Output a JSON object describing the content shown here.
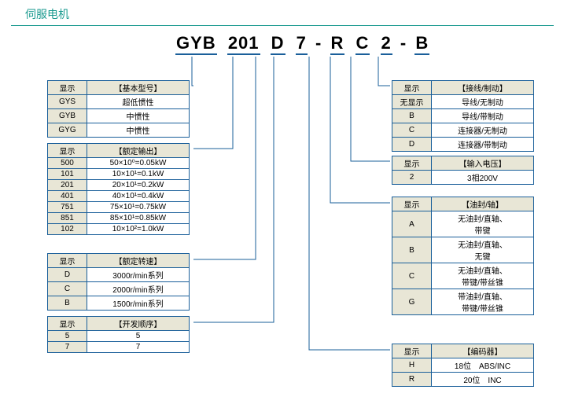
{
  "title": "伺服电机",
  "model": {
    "p1": "GYB",
    "p2": "201",
    "p3": "D",
    "p4": "7",
    "dash1": "-",
    "p5": "R",
    "p6": "C",
    "p7": "2",
    "dash2": "-",
    "p8": "B"
  },
  "t1": {
    "h1": "显示",
    "h2": "【基本型号】",
    "r": [
      [
        "GYS",
        "超低惯性"
      ],
      [
        "GYB",
        "中惯性"
      ],
      [
        "GYG",
        "中惯性"
      ]
    ]
  },
  "t2": {
    "h1": "显示",
    "h2": "【额定输出】",
    "r": [
      [
        "500",
        "50×10⁰=0.05kW"
      ],
      [
        "101",
        "10×10¹=0.1kW"
      ],
      [
        "201",
        "20×10¹=0.2kW"
      ],
      [
        "401",
        "40×10¹=0.4kW"
      ],
      [
        "751",
        "75×10¹=0.75kW"
      ],
      [
        "851",
        "85×10¹=0.85kW"
      ],
      [
        "102",
        "10×10²=1.0kW"
      ]
    ]
  },
  "t3": {
    "h1": "显示",
    "h2": "【额定转速】",
    "r": [
      [
        "D",
        "3000r/min系列"
      ],
      [
        "C",
        "2000r/min系列"
      ],
      [
        "B",
        "1500r/min系列"
      ]
    ]
  },
  "t4": {
    "h1": "显示",
    "h2": "【开发顺序】",
    "r": [
      [
        "5",
        "5"
      ],
      [
        "7",
        "7"
      ]
    ]
  },
  "t5": {
    "h1": "显示",
    "h2": "【接线/制动】",
    "r": [
      [
        "无显示",
        "导线/无制动"
      ],
      [
        "B",
        "导线/带制动"
      ],
      [
        "C",
        "连接器/无制动"
      ],
      [
        "D",
        "连接器/带制动"
      ]
    ]
  },
  "t6": {
    "h1": "显示",
    "h2": "【输入电压】",
    "r": [
      [
        "2",
        "3相200V"
      ]
    ]
  },
  "t7": {
    "h1": "显示",
    "h2": "【油封/轴】",
    "r": [
      [
        "A",
        "无油封/直轴、\n带键"
      ],
      [
        "B",
        "无油封/直轴、\n无键"
      ],
      [
        "C",
        "无油封/直轴、\n带键/带丝锥"
      ],
      [
        "G",
        "带油封/直轴、\n带键/带丝锥"
      ]
    ]
  },
  "t8": {
    "h1": "显示",
    "h2": "【编码器】",
    "r": [
      [
        "H",
        "18位　ABS/INC"
      ],
      [
        "R",
        "20位　INC"
      ]
    ]
  }
}
